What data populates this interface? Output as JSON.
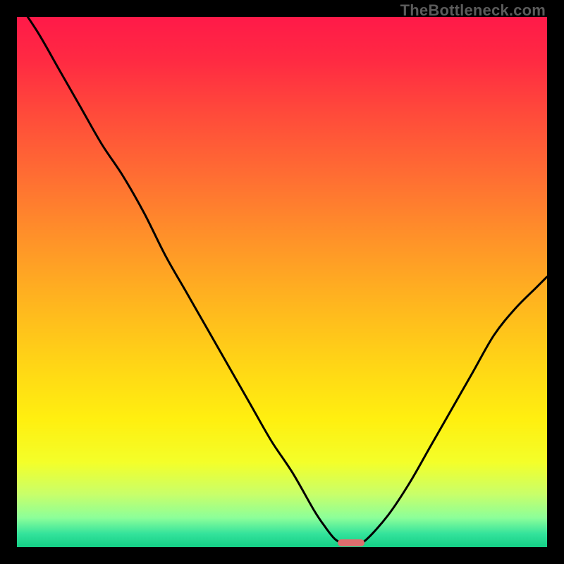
{
  "watermark": {
    "text": "TheBottleneck.com"
  },
  "gradient": {
    "stops": [
      {
        "offset": 0.0,
        "color": "#ff1a49"
      },
      {
        "offset": 0.08,
        "color": "#ff2a43"
      },
      {
        "offset": 0.18,
        "color": "#ff4a3b"
      },
      {
        "offset": 0.3,
        "color": "#ff6e33"
      },
      {
        "offset": 0.42,
        "color": "#ff9329"
      },
      {
        "offset": 0.54,
        "color": "#ffb61f"
      },
      {
        "offset": 0.66,
        "color": "#ffd716"
      },
      {
        "offset": 0.76,
        "color": "#fff010"
      },
      {
        "offset": 0.84,
        "color": "#f4ff2a"
      },
      {
        "offset": 0.9,
        "color": "#c9ff6a"
      },
      {
        "offset": 0.945,
        "color": "#8cff9a"
      },
      {
        "offset": 0.975,
        "color": "#34e39c"
      },
      {
        "offset": 1.0,
        "color": "#14cf86"
      }
    ]
  },
  "chart_data": {
    "type": "line",
    "title": "",
    "xlabel": "",
    "ylabel": "",
    "xlim": [
      0,
      100
    ],
    "ylim": [
      0,
      100
    ],
    "series": [
      {
        "name": "bottleneck-curve",
        "x": [
          0,
          4,
          8,
          12,
          16,
          20,
          24,
          28,
          32,
          36,
          40,
          44,
          48,
          52,
          56,
          58,
          60,
          62,
          64,
          66,
          70,
          74,
          78,
          82,
          86,
          90,
          94,
          98,
          100
        ],
        "y": [
          103,
          97,
          90,
          83,
          76,
          70,
          63,
          55,
          48,
          41,
          34,
          27,
          20,
          14,
          7,
          4,
          1.5,
          0.5,
          0.5,
          1.5,
          6,
          12,
          19,
          26,
          33,
          40,
          45,
          49,
          51
        ]
      }
    ],
    "marker": {
      "x": 63,
      "y": 0.8,
      "width_pct": 5.0,
      "height_pct": 1.4,
      "color": "#de6e6e"
    },
    "grid": false,
    "legend": false
  }
}
